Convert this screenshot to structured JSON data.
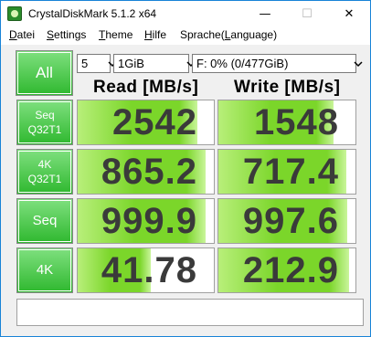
{
  "window": {
    "title": "CrystalDiskMark 5.1.2 x64"
  },
  "titlebar": {
    "minimize": "—",
    "maximize": "☐",
    "close": "✕"
  },
  "menu": [
    {
      "underline": "D",
      "rest": "atei"
    },
    {
      "underline": "S",
      "rest": "ettings"
    },
    {
      "underline": "T",
      "rest": "heme"
    },
    {
      "underline": "H",
      "rest": "ilfe"
    },
    {
      "underline": "",
      "rest": "Sprache(",
      "underline2": "L",
      "rest2": "anguage)"
    }
  ],
  "toolbar": {
    "all_label": "All",
    "count": "5",
    "size": "1GiB",
    "drive": "F: 0% (0/477GiB)"
  },
  "headers": {
    "read": "Read [MB/s]",
    "write": "Write [MB/s]"
  },
  "rows": [
    {
      "label1": "Seq",
      "label2": "Q32T1",
      "read": "2542",
      "write": "1548",
      "read_fill": 0.88,
      "write_fill": 0.84
    },
    {
      "label1": "4K",
      "label2": "Q32T1",
      "read": "865.2",
      "write": "717.4",
      "read_fill": 0.94,
      "write_fill": 0.93
    },
    {
      "label1": "Seq",
      "label2": "",
      "read": "999.9",
      "write": "997.6",
      "read_fill": 0.94,
      "write_fill": 0.94
    },
    {
      "label1": "4K",
      "label2": "",
      "read": "41.78",
      "write": "212.9",
      "read_fill": 0.54,
      "write_fill": 0.95
    }
  ],
  "colors": {
    "button_green": "#2fb82f",
    "bar_green": "#7bd62a",
    "value_text": "#3a3a3a",
    "window_border": "#1883d7"
  }
}
